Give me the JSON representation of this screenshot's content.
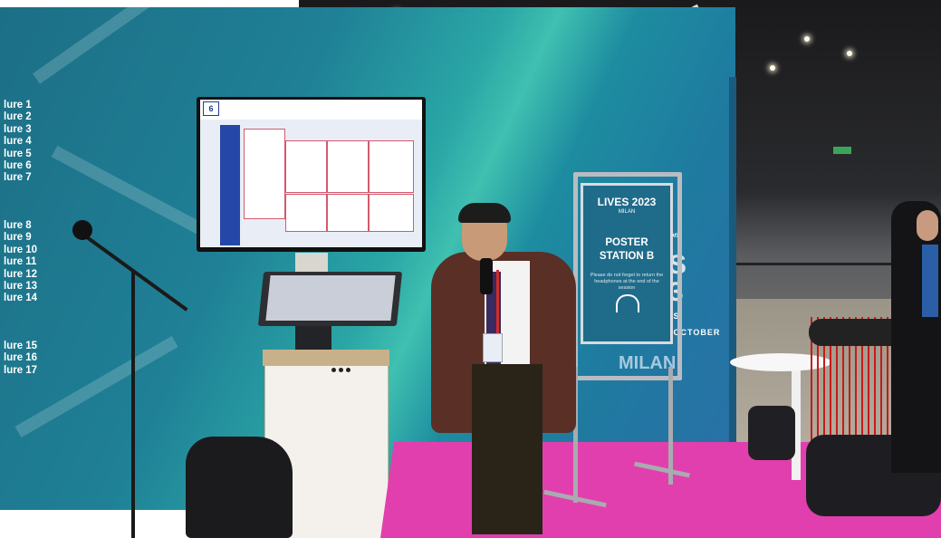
{
  "left_wall": {
    "figure_labels_group1": [
      "lure 1",
      "lure 2",
      "lure 3",
      "lure 4",
      "lure 5",
      "lure 6",
      "lure 7"
    ],
    "figure_labels_group2": [
      "lure 8",
      "lure 9",
      "lure 10",
      "lure 11",
      "lure 12",
      "lure 13",
      "lure 14"
    ],
    "figure_labels_group3": [
      "lure 15",
      "lure 16",
      "lure 17"
    ]
  },
  "tv": {
    "poster_number": "6"
  },
  "easel_poster": {
    "brand": "LIVES 2023",
    "brand_city": "MILAN",
    "title_line1": "POSTER",
    "title_line2": "STATION B",
    "note": "Please do not forget to return the headphones at the end of the session"
  },
  "wall_graphic": {
    "dates": "21-25 OCTOBER",
    "city": "MILAN"
  },
  "colors": {
    "wall_teal": "#1f8096",
    "carpet_magenta": "#e23fae",
    "lanyard_red": "#c61a1a"
  }
}
